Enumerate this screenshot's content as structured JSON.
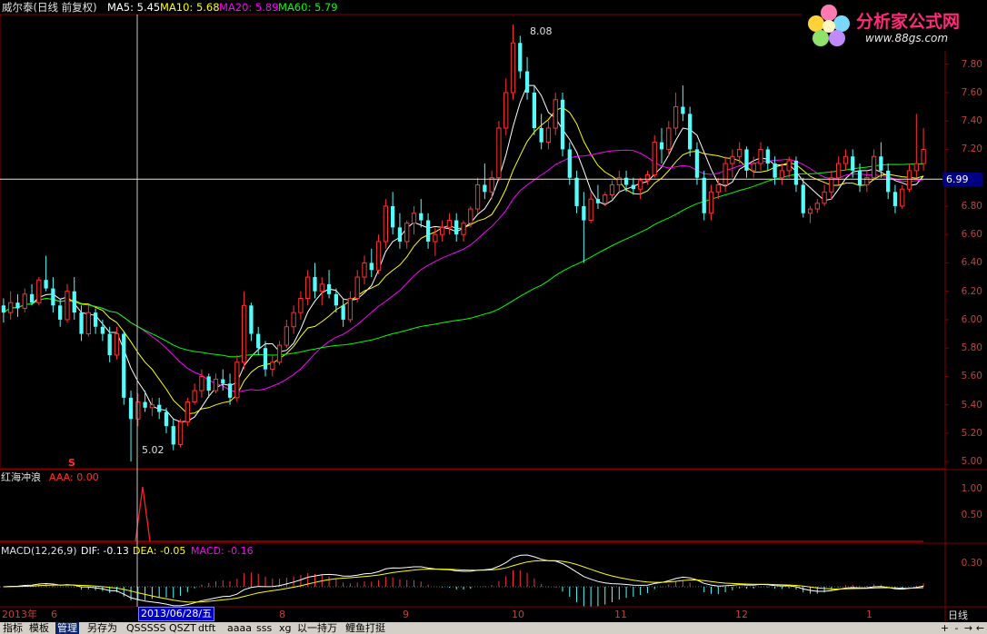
{
  "header": {
    "stock_title": "威尔泰(日线 前复权)",
    "ma5": "MA5: 5.45",
    "ma10": "MA10: 5.68",
    "ma20": "MA20: 5.89",
    "ma60": "MA60: 5.79"
  },
  "logo": {
    "name": "分析家公式网",
    "url": "www.88gs.com",
    "icon": "flower-logo-icon"
  },
  "price_axis": [
    "7.80",
    "7.60",
    "7.40",
    "7.20",
    "7.00",
    "6.80",
    "6.60",
    "6.40",
    "6.20",
    "6.00",
    "5.80",
    "5.60",
    "5.40",
    "5.20",
    "5.00"
  ],
  "current_price": "6.99",
  "annotations": {
    "high": "8.08",
    "low": "5.02",
    "signal_marker": "S"
  },
  "indicator1": {
    "name": "红海冲浪",
    "value": "AAA: 0.00",
    "axis": [
      "1.00",
      "0.50"
    ]
  },
  "indicator2": {
    "name": "MACD(12,26,9)",
    "dif": "DIF: -0.13",
    "dea": "DEA: -0.05",
    "macd": "MACD: -0.16",
    "axis": [
      "0.30"
    ]
  },
  "date_axis": [
    "2013年",
    "6",
    "8",
    "9",
    "10",
    "11",
    "12",
    "1"
  ],
  "selected_date": "2013/06/28/五",
  "period": "日线",
  "toolbar": {
    "items": [
      "指标",
      "模板",
      "管理",
      "另存为",
      "QSSSSS",
      "QSZT",
      "dtft",
      "aaaa",
      "sss",
      "xg",
      "以一持万",
      "鲤鱼打挺"
    ],
    "active_index": 2,
    "buttons": [
      "+",
      "-",
      "→",
      "←"
    ]
  },
  "colors": {
    "up": "#ff3232",
    "down": "#54fcfc",
    "ma5": "#ffffff",
    "ma10": "#ffff00",
    "ma20": "#ff00ff",
    "ma60": "#00ff00",
    "grid": "#800000",
    "axis_text": "#c04040"
  },
  "chart_data": {
    "type": "candlestick",
    "ylim": [
      4.95,
      8.15
    ],
    "candles": [
      [
        6.1,
        6.15,
        5.98,
        6.05
      ],
      [
        6.05,
        6.2,
        6.0,
        6.12
      ],
      [
        6.12,
        6.18,
        6.02,
        6.08
      ],
      [
        6.08,
        6.22,
        6.05,
        6.18
      ],
      [
        6.18,
        6.25,
        6.1,
        6.12
      ],
      [
        6.12,
        6.3,
        6.1,
        6.28
      ],
      [
        6.28,
        6.45,
        6.2,
        6.22
      ],
      [
        6.22,
        6.3,
        6.05,
        6.1
      ],
      [
        6.1,
        6.15,
        5.95,
        6.0
      ],
      [
        6.0,
        6.25,
        5.98,
        6.2
      ],
      [
        6.2,
        6.3,
        6.0,
        6.05
      ],
      [
        6.05,
        6.1,
        5.85,
        5.9
      ],
      [
        5.9,
        6.1,
        5.88,
        6.05
      ],
      [
        6.05,
        6.08,
        5.9,
        5.95
      ],
      [
        5.95,
        6.0,
        5.85,
        5.9
      ],
      [
        5.9,
        5.95,
        5.7,
        5.75
      ],
      [
        5.75,
        5.95,
        5.72,
        5.9
      ],
      [
        5.9,
        5.92,
        5.4,
        5.45
      ],
      [
        5.45,
        5.5,
        5.0,
        5.3
      ],
      [
        5.3,
        5.48,
        5.25,
        5.42
      ],
      [
        5.42,
        5.5,
        5.35,
        5.38
      ],
      [
        5.38,
        5.45,
        5.32,
        5.4
      ],
      [
        5.4,
        5.45,
        5.3,
        5.35
      ],
      [
        5.35,
        5.38,
        5.2,
        5.25
      ],
      [
        5.25,
        5.3,
        5.08,
        5.12
      ],
      [
        5.12,
        5.3,
        5.1,
        5.28
      ],
      [
        5.28,
        5.45,
        5.25,
        5.42
      ],
      [
        5.42,
        5.55,
        5.4,
        5.5
      ],
      [
        5.5,
        5.65,
        5.45,
        5.6
      ],
      [
        5.6,
        5.62,
        5.45,
        5.5
      ],
      [
        5.5,
        5.62,
        5.48,
        5.58
      ],
      [
        5.58,
        5.65,
        5.5,
        5.55
      ],
      [
        5.55,
        5.62,
        5.4,
        5.45
      ],
      [
        5.45,
        5.75,
        5.42,
        5.7
      ],
      [
        5.7,
        6.2,
        5.65,
        6.1
      ],
      [
        6.1,
        6.12,
        5.85,
        5.9
      ],
      [
        5.9,
        5.95,
        5.75,
        5.8
      ],
      [
        5.8,
        5.85,
        5.6,
        5.65
      ],
      [
        5.65,
        5.75,
        5.6,
        5.7
      ],
      [
        5.7,
        5.85,
        5.68,
        5.82
      ],
      [
        5.82,
        6.0,
        5.8,
        5.95
      ],
      [
        5.95,
        6.1,
        5.9,
        6.05
      ],
      [
        6.05,
        6.2,
        6.0,
        6.15
      ],
      [
        6.15,
        6.35,
        6.1,
        6.3
      ],
      [
        6.3,
        6.4,
        6.15,
        6.2
      ],
      [
        6.2,
        6.3,
        6.1,
        6.25
      ],
      [
        6.25,
        6.35,
        6.15,
        6.18
      ],
      [
        6.18,
        6.22,
        6.05,
        6.1
      ],
      [
        6.1,
        6.15,
        5.95,
        6.0
      ],
      [
        6.0,
        6.2,
        5.98,
        6.15
      ],
      [
        6.15,
        6.35,
        6.12,
        6.3
      ],
      [
        6.3,
        6.45,
        6.25,
        6.4
      ],
      [
        6.4,
        6.5,
        6.3,
        6.35
      ],
      [
        6.35,
        6.6,
        6.32,
        6.55
      ],
      [
        6.55,
        6.85,
        6.5,
        6.8
      ],
      [
        6.8,
        6.9,
        6.6,
        6.65
      ],
      [
        6.65,
        6.75,
        6.5,
        6.55
      ],
      [
        6.55,
        6.7,
        6.5,
        6.68
      ],
      [
        6.68,
        6.8,
        6.6,
        6.75
      ],
      [
        6.75,
        6.85,
        6.65,
        6.7
      ],
      [
        6.7,
        6.75,
        6.5,
        6.55
      ],
      [
        6.55,
        6.65,
        6.45,
        6.6
      ],
      [
        6.6,
        6.7,
        6.55,
        6.65
      ],
      [
        6.65,
        6.75,
        6.6,
        6.7
      ],
      [
        6.7,
        6.75,
        6.55,
        6.6
      ],
      [
        6.6,
        6.7,
        6.55,
        6.68
      ],
      [
        6.68,
        6.8,
        6.65,
        6.78
      ],
      [
        6.78,
        7.0,
        6.75,
        6.95
      ],
      [
        6.95,
        7.1,
        6.85,
        6.9
      ],
      [
        6.9,
        7.05,
        6.85,
        7.0
      ],
      [
        7.0,
        7.4,
        6.98,
        7.35
      ],
      [
        7.35,
        7.7,
        7.3,
        7.6
      ],
      [
        7.6,
        8.08,
        7.55,
        7.95
      ],
      [
        7.95,
        8.0,
        7.7,
        7.75
      ],
      [
        7.75,
        7.85,
        7.55,
        7.6
      ],
      [
        7.6,
        7.65,
        7.3,
        7.35
      ],
      [
        7.35,
        7.45,
        7.2,
        7.25
      ],
      [
        7.25,
        7.4,
        7.2,
        7.35
      ],
      [
        7.35,
        7.6,
        7.3,
        7.55
      ],
      [
        7.55,
        7.6,
        7.15,
        7.2
      ],
      [
        7.2,
        7.25,
        6.95,
        7.0
      ],
      [
        7.0,
        7.05,
        6.75,
        6.8
      ],
      [
        6.8,
        6.9,
        6.4,
        6.7
      ],
      [
        6.7,
        6.9,
        6.68,
        6.85
      ],
      [
        6.85,
        6.95,
        6.78,
        6.82
      ],
      [
        6.82,
        6.9,
        6.8,
        6.88
      ],
      [
        6.88,
        6.98,
        6.85,
        6.95
      ],
      [
        6.95,
        7.05,
        6.9,
        7.0
      ],
      [
        7.0,
        7.05,
        6.9,
        6.95
      ],
      [
        6.95,
        7.0,
        6.88,
        6.92
      ],
      [
        6.92,
        7.0,
        6.85,
        6.98
      ],
      [
        6.98,
        7.05,
        6.95,
        7.02
      ],
      [
        7.02,
        7.3,
        7.0,
        7.25
      ],
      [
        7.25,
        7.35,
        7.1,
        7.2
      ],
      [
        7.2,
        7.4,
        7.15,
        7.35
      ],
      [
        7.35,
        7.6,
        7.3,
        7.5
      ],
      [
        7.5,
        7.65,
        7.4,
        7.45
      ],
      [
        7.45,
        7.5,
        7.15,
        7.2
      ],
      [
        7.2,
        7.25,
        6.95,
        7.0
      ],
      [
        7.0,
        7.05,
        6.7,
        6.75
      ],
      [
        6.75,
        6.95,
        6.7,
        6.9
      ],
      [
        6.9,
        7.0,
        6.85,
        6.95
      ],
      [
        6.95,
        7.15,
        6.9,
        7.1
      ],
      [
        7.1,
        7.2,
        7.0,
        7.15
      ],
      [
        7.15,
        7.25,
        7.1,
        7.2
      ],
      [
        7.2,
        7.22,
        7.0,
        7.05
      ],
      [
        7.05,
        7.15,
        7.0,
        7.1
      ],
      [
        7.1,
        7.25,
        7.05,
        7.2
      ],
      [
        7.2,
        7.22,
        7.05,
        7.1
      ],
      [
        7.1,
        7.15,
        6.95,
        7.0
      ],
      [
        7.0,
        7.1,
        6.95,
        7.05
      ],
      [
        7.05,
        7.15,
        7.0,
        7.12
      ],
      [
        7.12,
        7.15,
        6.9,
        6.95
      ],
      [
        6.95,
        7.0,
        6.72,
        6.75
      ],
      [
        6.75,
        6.8,
        6.68,
        6.78
      ],
      [
        6.78,
        6.85,
        6.75,
        6.82
      ],
      [
        6.82,
        6.95,
        6.8,
        6.9
      ],
      [
        6.9,
        7.05,
        6.85,
        7.0
      ],
      [
        7.0,
        7.15,
        6.95,
        7.1
      ],
      [
        7.1,
        7.2,
        7.05,
        7.15
      ],
      [
        7.15,
        7.2,
        7.0,
        7.05
      ],
      [
        7.05,
        7.1,
        6.9,
        6.95
      ],
      [
        6.95,
        7.05,
        6.9,
        7.0
      ],
      [
        7.0,
        7.2,
        6.98,
        7.15
      ],
      [
        7.15,
        7.25,
        7.0,
        7.05
      ],
      [
        7.05,
        7.1,
        6.85,
        6.9
      ],
      [
        6.9,
        6.95,
        6.75,
        6.8
      ],
      [
        6.8,
        6.95,
        6.78,
        6.92
      ],
      [
        6.92,
        7.1,
        6.9,
        7.05
      ],
      [
        7.05,
        7.45,
        7.0,
        7.1
      ],
      [
        7.1,
        7.35,
        7.05,
        7.2
      ]
    ],
    "ma_values": {
      "MA5": 5.45,
      "MA10": 5.68,
      "MA20": 5.89,
      "MA60": 5.79
    }
  }
}
